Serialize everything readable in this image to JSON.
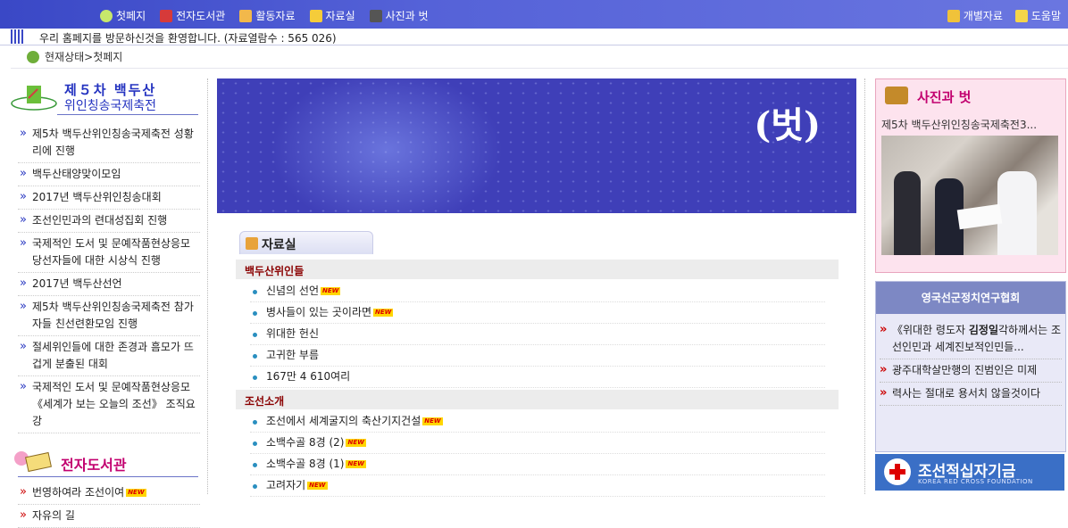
{
  "topnav": {
    "left": [
      {
        "label": "첫페지",
        "icon": "home-icon"
      },
      {
        "label": "전자도서관",
        "icon": "book-icon"
      },
      {
        "label": "활동자료",
        "icon": "pencil-icon"
      },
      {
        "label": "자료실",
        "icon": "folder-icon"
      },
      {
        "label": "사진과 벗",
        "icon": "camera-icon"
      }
    ],
    "right": [
      {
        "label": "개별자료",
        "icon": "note-icon"
      },
      {
        "label": "도움말",
        "icon": "help-icon"
      }
    ]
  },
  "welcome": {
    "text": "우리 홈페지를 방문하신것을 환영합니다.   (자료열람수 : 565 026)"
  },
  "breadcrumb": {
    "text": "현재상태>첫페지"
  },
  "left": {
    "festival_title_1": "제５차  백두산",
    "festival_title_2": "위인칭송국제축전",
    "festival_items": [
      {
        "label": "제5차 백두산위인칭송국제축전 성황리에 진행"
      },
      {
        "label": "백두산태양맞이모임"
      },
      {
        "label": "2017년 백두산위인칭송대회"
      },
      {
        "label": "조선인민과의 련대성집회 진행"
      },
      {
        "label": "국제적인 도서 및 문예작품현상응모 당선자들에 대한 시상식 진행"
      },
      {
        "label": "2017년 백두산선언"
      },
      {
        "label": "제5차 백두산위인칭송국제축전 참가자들 친선련환모임 진행"
      },
      {
        "label": "절세위인들에 대한 존경과 흠모가 뜨겁게 분출된 대회"
      },
      {
        "label": "국제적인 도서 및 문예작품현상응모 《세계가 보는 오늘의 조선》 조직요강"
      }
    ],
    "library_title": "전자도서관",
    "library_items": [
      {
        "label": "번영하여라 조선이여",
        "new": "NEW"
      },
      {
        "label": "자유의 길"
      }
    ]
  },
  "banner": {
    "logo": "(벗)"
  },
  "center": {
    "tab_title": "자료실",
    "section1": "백두산위인들",
    "section1_items": [
      {
        "label": "신념의 선언",
        "new": "NEW"
      },
      {
        "label": "병사들이 있는 곳이라면",
        "new": "NEW"
      },
      {
        "label": "위대한 헌신"
      },
      {
        "label": "고귀한 부름"
      },
      {
        "label": "167만 4 610여리"
      }
    ],
    "section2": "조선소개",
    "section2_items": [
      {
        "label": "조선에서 세계굴지의 축산기지건설",
        "new": "NEW"
      },
      {
        "label": "소백수골 8경 (2)",
        "new": "NEW"
      },
      {
        "label": "소백수골 8경 (1)",
        "new": "NEW"
      },
      {
        "label": "고려자기",
        "new": "NEW"
      }
    ]
  },
  "right": {
    "photo_title": "사진과 벗",
    "photo_caption": "제5차 백두산위인칭송국제축전3...",
    "assoc_title": "영국선군정치연구협회",
    "assoc_items": [
      {
        "prefix": "《위대한 령도자 ",
        "bold": "김정일",
        "suffix": "각하께서는 조선인민과 세계진보적인민들..."
      },
      {
        "prefix": "광주대학살만행의 진범인은 미제",
        "bold": "",
        "suffix": ""
      },
      {
        "prefix": "력사는 절대로 용서치 않을것이다",
        "bold": "",
        "suffix": ""
      }
    ],
    "redcross_title": "조선적십자기금",
    "redcross_sub": "KOREA RED CROSS FOUNDATION"
  },
  "colors": {
    "nav_bg": "#3a48c6",
    "heading_blue": "#2433c0",
    "heading_pink": "#c2006f",
    "section_red": "#8a0000"
  }
}
